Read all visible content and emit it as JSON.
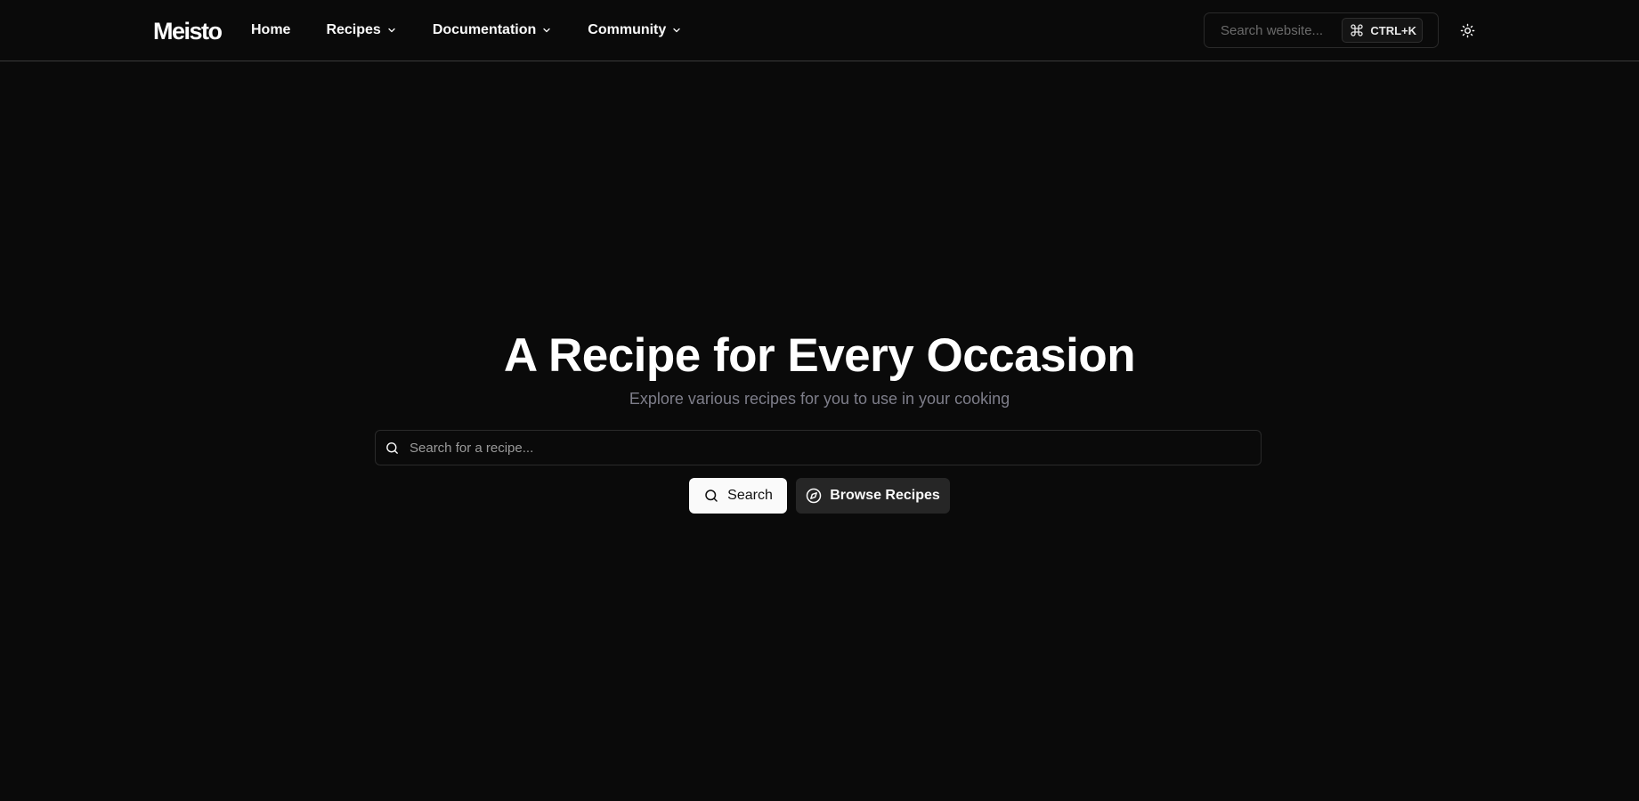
{
  "header": {
    "logo": "Meisto",
    "nav": [
      {
        "label": "Home",
        "has_dropdown": false
      },
      {
        "label": "Recipes",
        "has_dropdown": true
      },
      {
        "label": "Documentation",
        "has_dropdown": true
      },
      {
        "label": "Community",
        "has_dropdown": true
      }
    ],
    "site_search": {
      "placeholder": "Search website...",
      "shortcut_icon": "command-icon",
      "shortcut": "CTRL+K"
    },
    "theme_toggle_icon": "sun-icon"
  },
  "hero": {
    "title": "A Recipe for Every Occasion",
    "subtitle": "Explore various recipes for you to use in your cooking",
    "search": {
      "icon": "search-icon",
      "placeholder": "Search for a recipe...",
      "value": ""
    },
    "buttons": {
      "search_label": "Search",
      "search_icon": "search-icon",
      "browse_label": "Browse Recipes",
      "browse_icon": "compass-icon"
    }
  },
  "colors": {
    "background": "#0a0a0a",
    "border": "#3a3a3a",
    "text": "#fafafa",
    "muted_text": "#7e7e8a",
    "primary_button_bg": "#fafafa",
    "secondary_button_bg": "#262626"
  }
}
